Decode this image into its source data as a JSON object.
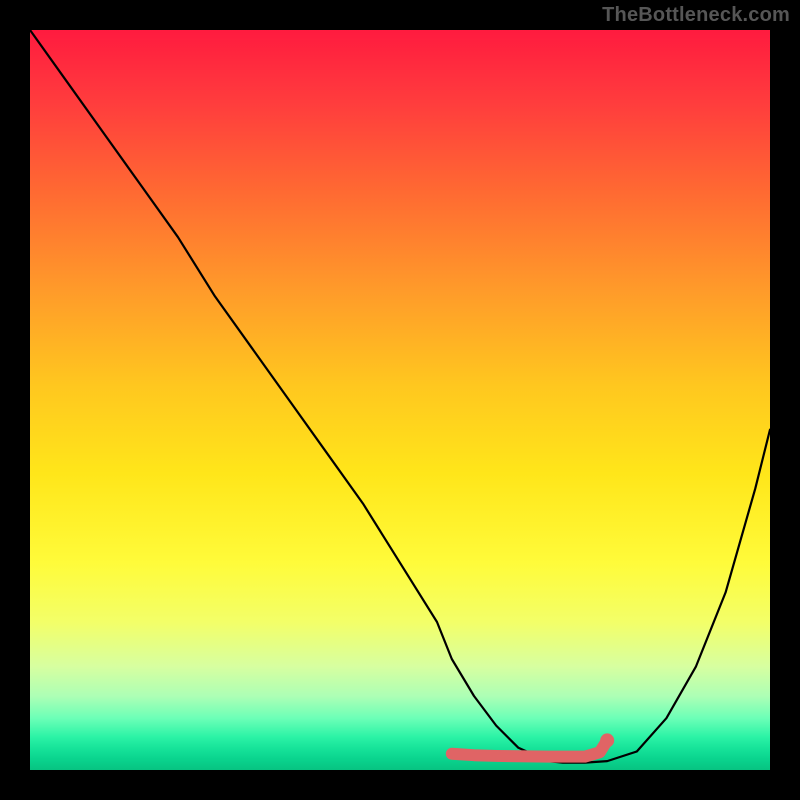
{
  "watermark": "TheBottleneck.com",
  "chart_data": {
    "type": "line",
    "title": "",
    "xlabel": "",
    "ylabel": "",
    "xlim": [
      0,
      100
    ],
    "ylim": [
      0,
      100
    ],
    "grid": false,
    "legend": false,
    "description": "V-shaped bottleneck curve with sweet-spot trough over vertical red-to-green gradient background.",
    "series": [
      {
        "name": "bottleneck_curve",
        "color": "#000000",
        "x": [
          0,
          5,
          10,
          15,
          20,
          25,
          30,
          35,
          40,
          45,
          50,
          55,
          57,
          60,
          63,
          66,
          70,
          72,
          75,
          78,
          82,
          86,
          90,
          94,
          98,
          100
        ],
        "y": [
          100,
          93,
          86,
          79,
          72,
          64,
          57,
          50,
          43,
          36,
          28,
          20,
          15,
          10,
          6,
          3,
          1.2,
          1,
          1,
          1.2,
          2.5,
          7,
          14,
          24,
          38,
          46
        ]
      }
    ],
    "sweet_spot_marker": {
      "name": "optimal_range",
      "color": "#e06465",
      "x": [
        57,
        60,
        63,
        66,
        70,
        72,
        75,
        77,
        78
      ],
      "y": [
        2.2,
        2.0,
        1.9,
        1.85,
        1.8,
        1.8,
        1.8,
        2.4,
        4.0
      ]
    }
  },
  "gradient_stops": [
    {
      "pct": 0,
      "color": "#ff1b3f"
    },
    {
      "pct": 50,
      "color": "#ffe61a"
    },
    {
      "pct": 100,
      "color": "#07c381"
    }
  ]
}
